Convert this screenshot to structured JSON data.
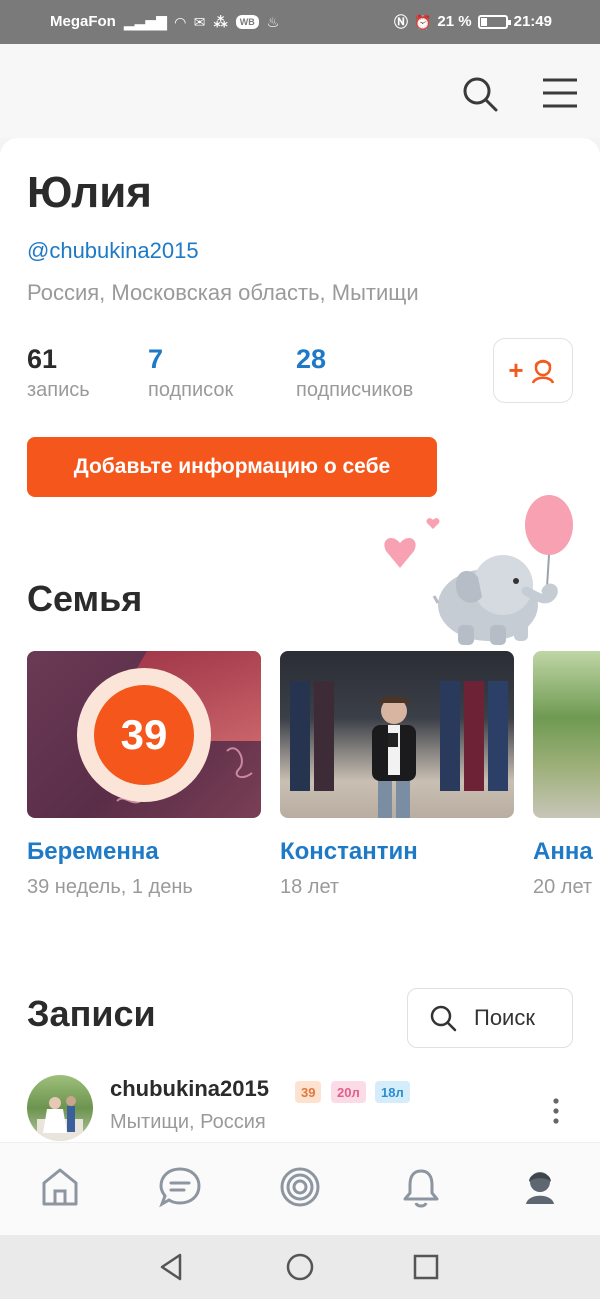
{
  "status_bar": {
    "carrier": "MegaFon",
    "battery_percent": "21 %",
    "time": "21:49",
    "badge_wb": "WB"
  },
  "profile": {
    "name": "Юлия",
    "handle": "@chubukina2015",
    "location": "Россия, Московская область, Мытищи",
    "stats": [
      {
        "value": "61",
        "label": "запись"
      },
      {
        "value": "7",
        "label": "подписок"
      },
      {
        "value": "28",
        "label": "подписчиков"
      }
    ],
    "add_friend_plus": "+",
    "info_button": "Добавьте информацию о себе"
  },
  "family": {
    "title": "Семья",
    "members": [
      {
        "name": "Беременна",
        "sub": "39 недель, 1 день",
        "badge": "39"
      },
      {
        "name": "Константин",
        "sub": "18 лет"
      },
      {
        "name": "Анна",
        "sub": "20 лет"
      }
    ]
  },
  "posts": {
    "title": "Записи",
    "search_label": "Поиск",
    "first_post": {
      "user": "chubukina2015",
      "location": "Мытищи, Россия",
      "tags": [
        "39",
        "20л",
        "18л"
      ]
    }
  },
  "colors": {
    "accent_orange": "#f4561c",
    "link_blue": "#1e7ac6"
  }
}
